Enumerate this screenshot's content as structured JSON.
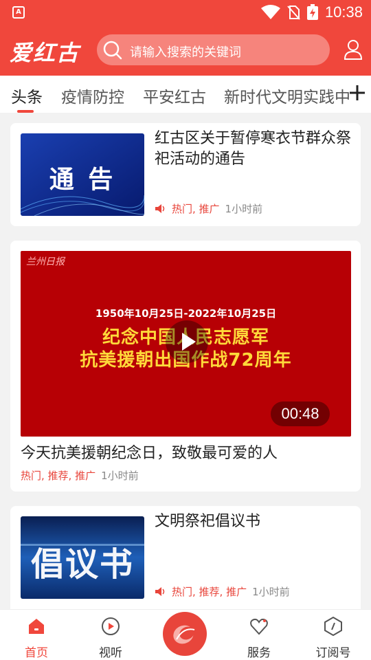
{
  "status_bar": {
    "time": "10:38",
    "app_icon_letter": "A"
  },
  "header": {
    "logo": "爱红古",
    "search_placeholder": "请输入搜索的关键词"
  },
  "tabs": [
    {
      "label": "头条",
      "active": true
    },
    {
      "label": "疫情防控"
    },
    {
      "label": "平安红古"
    },
    {
      "label": "新时代文明实践中"
    }
  ],
  "feed": [
    {
      "title": "红古区关于暂停寒衣节群众祭祀活动的通告",
      "thumb_text": "通 告",
      "tags": "热门, 推广",
      "time_ago": "1小时前"
    },
    {
      "video_brand": "兰州日报",
      "video_date": "1950年10月25日-2022年10月25日",
      "video_line1": "纪念中国人民志愿军",
      "video_line2": "抗美援朝出国作战72周年",
      "duration": "00:48",
      "title": "今天抗美援朝纪念日，致敬最可爱的人",
      "tags": "热门, 推荐, 推广",
      "time_ago": "1小时前"
    },
    {
      "title": "文明祭祀倡议书",
      "thumb_text": "倡议书",
      "tags": "热门, 推荐, 推广",
      "time_ago": "1小时前"
    }
  ],
  "bottom_nav": [
    {
      "label": "首页",
      "icon": "home-icon",
      "active": true
    },
    {
      "label": "视听",
      "icon": "play-circle-icon"
    },
    {
      "label": "",
      "icon": "center-logo-icon"
    },
    {
      "label": "服务",
      "icon": "heart-icon"
    },
    {
      "label": "订阅号",
      "icon": "compass-icon"
    }
  ],
  "colors": {
    "brand_red": "#f0473c",
    "tag_red": "#e8453b",
    "video_bg": "#b70005",
    "title_yellow": "#ffd93a"
  }
}
